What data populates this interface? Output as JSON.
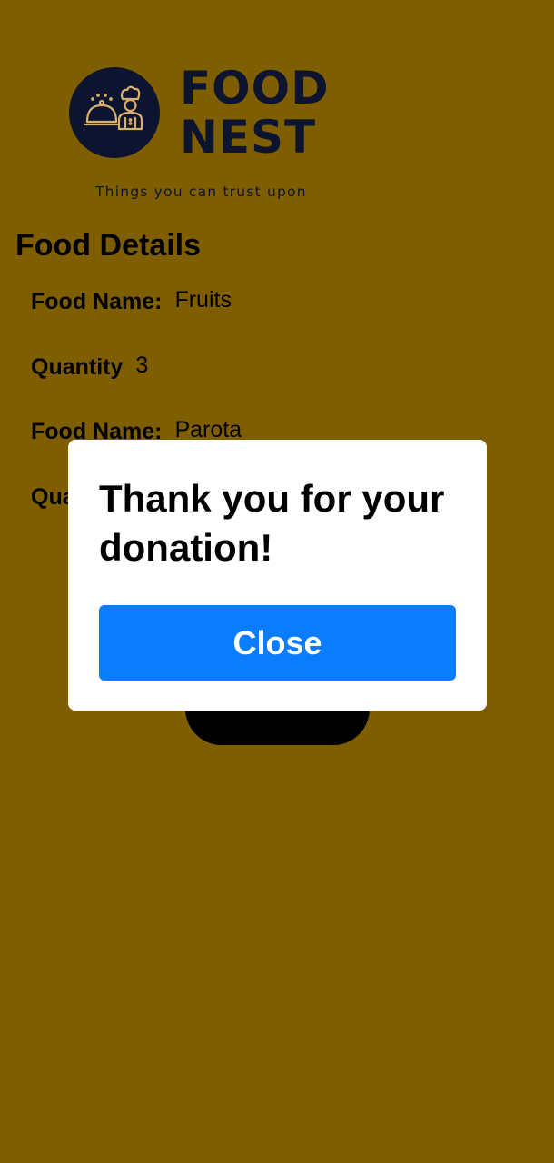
{
  "logo": {
    "brand_line1": "FOOD",
    "brand_line2": "NEST",
    "tagline": "Things you can trust upon",
    "icon": "chef-serving-dish-icon"
  },
  "details": {
    "title": "Food Details",
    "rows": [
      {
        "label": "Food Name:",
        "value": "Fruits"
      },
      {
        "label": "Quantity",
        "value": "3"
      },
      {
        "label": "Food Name:",
        "value": "Parota"
      },
      {
        "label": "Qua",
        "value": ""
      }
    ]
  },
  "modal": {
    "message": "Thank you for your donation!",
    "close_label": "Close"
  },
  "colors": {
    "background": "#7f5e00",
    "brand_navy": "#0d1430",
    "button_blue": "#0a7cff",
    "modal_bg": "#ffffff"
  }
}
